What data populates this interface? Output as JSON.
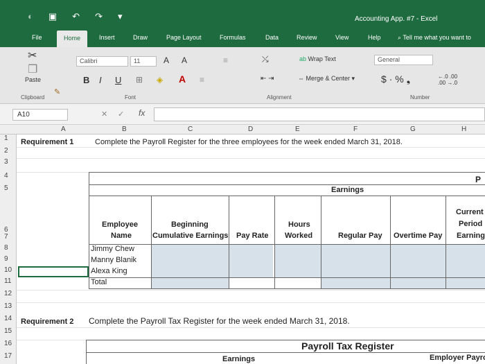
{
  "window": {
    "title": "Accounting App. #7  -  Excel"
  },
  "tabs": [
    "File",
    "Home",
    "Insert",
    "Draw",
    "Page Layout",
    "Formulas",
    "Data",
    "Review",
    "View",
    "Help"
  ],
  "tell_me": "Tell me what you want to",
  "ribbon": {
    "font_name": "Calibri",
    "font_size": "11",
    "paste": "Paste",
    "wrap_text": "Wrap Text",
    "merge_center": "Merge & Center",
    "number_format": "General",
    "groups": {
      "clipboard": "Clipboard",
      "font": "Font",
      "alignment": "Alignment",
      "number": "Number"
    }
  },
  "formula_bar": {
    "name_box": "A10",
    "fx": "fx"
  },
  "columns": [
    "A",
    "B",
    "C",
    "D",
    "E",
    "F",
    "G",
    "H"
  ],
  "rows": [
    "1",
    "2",
    "3",
    "4",
    "5",
    "6",
    "7",
    "8",
    "9",
    "10",
    "11",
    "12",
    "13",
    "14",
    "15",
    "16",
    "17"
  ],
  "sheet": {
    "req1": "Requirement 1",
    "req1_text": "Complete the Payroll Register for the three employees for the week ended March 31, 2018.",
    "earnings": "Earnings",
    "p_cut": "P",
    "h_employee": "Employee",
    "h_name": "Name",
    "h_beginning": "Beginning",
    "h_cumulative": "Cumulative Earnings",
    "h_payrate": "Pay Rate",
    "h_hours": "Hours",
    "h_worked": "Worked",
    "h_regular": "Regular Pay",
    "h_overtime": "Overtime Pay",
    "h_current": "Current",
    "h_period": "Period",
    "h_earnings_cut": "Earnings",
    "employees": [
      "Jimmy Chew",
      "Manny Blanik",
      "Alexa King"
    ],
    "total": "Total",
    "req2": "Requirement 2",
    "req2_text": "Complete the Payroll Tax Register for the week ended March 31, 2018.",
    "ptr_title": "Payroll Tax Register",
    "ptr_earnings": "Earnings",
    "ptr_employer": "Employer Payro"
  }
}
